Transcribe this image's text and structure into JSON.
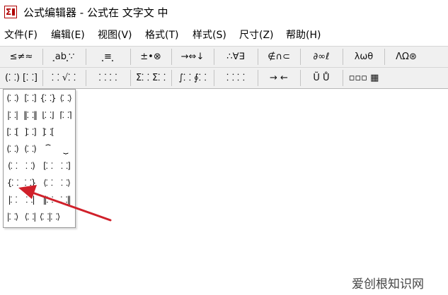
{
  "window": {
    "title": "公式编辑器 - 公式在 文字文 中",
    "icon": "formula-editor-icon"
  },
  "menu": {
    "items": [
      "文件(F)",
      "编辑(E)",
      "视图(V)",
      "格式(T)",
      "样式(S)",
      "尺寸(Z)",
      "帮助(H)"
    ]
  },
  "palette_row1": {
    "buttons": [
      "≤≠≈",
      "⸼ab⸼∵",
      "⸼≡⸼",
      "±•⊗",
      "→⇔↓",
      "∴∀∃",
      "∉∩⊂",
      "∂∞ℓ",
      "λωθ",
      "ΛΩ⊛"
    ]
  },
  "palette_row2": {
    "buttons": [
      "(⸬) [⸬]",
      "⸬ √⸬",
      "⸬ ⸬",
      "Σ⸬ Σ⸬",
      "∫⸬ ∮⸬",
      "⸬ ⸬",
      "→ ←",
      "Ũ Ů",
      "▫▫▫ ▦"
    ]
  },
  "template_palette": {
    "rows": [
      [
        "(⸬)",
        "[⸬]",
        "{⸬}",
        "⟨⸬⟩"
      ],
      [
        "|⸬|",
        "‖⸬‖",
        "⌊⸬⌋",
        "⌈⸬⌉"
      ],
      [
        "[⸬[",
        "]⸬]",
        "]⸬[",
        ""
      ],
      [
        "(⸬)",
        "(⸬)",
        "⏞",
        "⏟"
      ],
      [
        "(⸬",
        "⸬)",
        "[⸬",
        "⸬]"
      ],
      [
        "{⸬",
        "⸬}",
        "⟨⸬",
        "⸬⟩"
      ],
      [
        "|⸬",
        "⸬|",
        "‖⸬",
        "⸬‖"
      ],
      [
        "|⸬⟩",
        "⟨⸬|",
        "⟨⸬|⸬⟩",
        ""
      ]
    ]
  },
  "watermark": {
    "text": "爱创根知识网"
  },
  "colors": {
    "arrow": "#d0202a",
    "toolbar_bg": "#f0f0f0"
  }
}
